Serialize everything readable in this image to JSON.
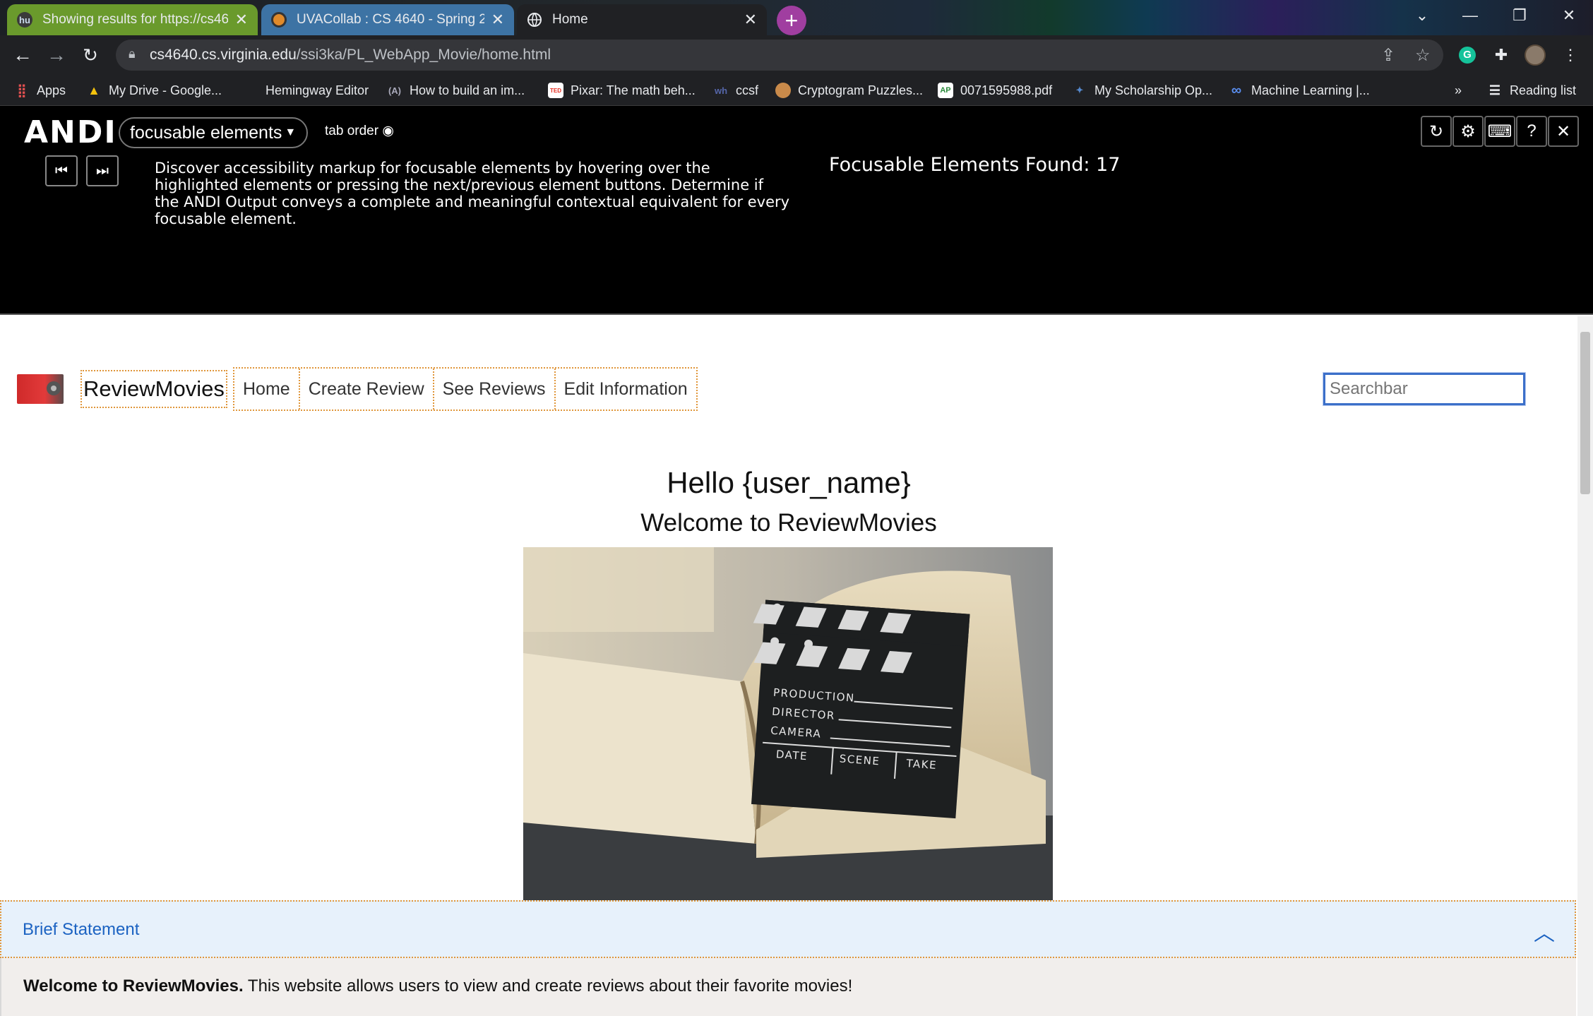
{
  "browser": {
    "tabs": [
      {
        "title": "Showing results for https://cs464",
        "favicon": "hu"
      },
      {
        "title": "UVACollab : CS 4640 - Spring 202",
        "favicon": ""
      },
      {
        "title": "Home",
        "favicon": ""
      }
    ],
    "url_host": "cs4640.cs.virginia.edu",
    "url_path": "/ssi3ka/PL_WebApp_Movie/home.html",
    "bookmarks": [
      "Apps",
      "My Drive - Google...",
      "Hemingway Editor",
      "How to build an im...",
      "Pixar: The math beh...",
      "ccsf",
      "Cryptogram Puzzles...",
      "0071595988.pdf",
      "My Scholarship Op...",
      "Machine Learning |..."
    ],
    "bookmarks_overflow": "»",
    "reading_list": "Reading list"
  },
  "andi": {
    "logo": "ANDI",
    "mode": "focusable elements",
    "tab_order": "tab order",
    "description": "Discover accessibility markup for focusable elements by hovering over the highlighted elements or pressing the next/previous element buttons. Determine if the ANDI Output conveys a complete and meaningful contextual equivalent for every focusable element.",
    "found": "Focusable Elements Found: 17"
  },
  "site": {
    "brand": "ReviewMovies",
    "nav": [
      "Home",
      "Create Review",
      "See Reviews",
      "Edit Information"
    ],
    "search_placeholder": "Searchbar",
    "hello": "Hello {user_name}",
    "welcome": "Welcome to ReviewMovies",
    "hero_clapper": {
      "production": "PRODUCTION",
      "director": "DIRECTOR",
      "camera": "CAMERA",
      "date": "DATE",
      "scene": "SCENE",
      "take": "TAKE"
    },
    "accordion_title": "Brief Statement",
    "statement_bold": "Welcome to ReviewMovies.",
    "statement_rest": " This website allows users to view and create reviews about their favorite movies!"
  }
}
